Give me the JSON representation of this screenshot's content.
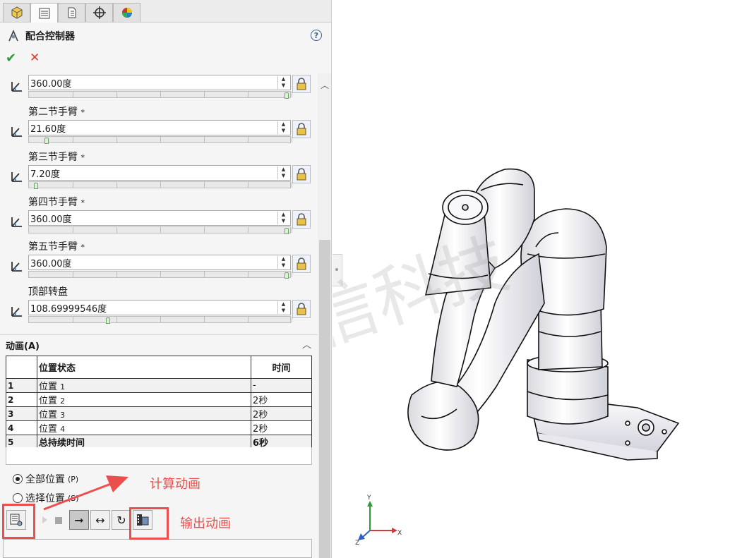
{
  "property_manager": {
    "title": "配合控制器",
    "help": "?",
    "ok": "✔",
    "cancel": "✕"
  },
  "mates": [
    {
      "label": "",
      "value": "360.00度",
      "slider": 1.0
    },
    {
      "label": "第二节手臂",
      "required": "*",
      "value": "21.60度",
      "slider": 0.06
    },
    {
      "label": "第三节手臂",
      "required": "*",
      "value": "7.20度",
      "slider": 0.02
    },
    {
      "label": "第四节手臂",
      "required": "*",
      "value": "360.00度",
      "slider": 1.0
    },
    {
      "label": "第五节手臂",
      "required": "*",
      "value": "360.00度",
      "slider": 1.0
    },
    {
      "label": "顶部转盘",
      "required": "",
      "value": "108.69999546度",
      "slider": 0.3
    }
  ],
  "animation": {
    "section_title": "动画(A)",
    "col_position": "位置状态",
    "col_time": "时间",
    "rows": [
      {
        "idx": "1",
        "name": "位置",
        "num": "1",
        "time": "-"
      },
      {
        "idx": "2",
        "name": "位置",
        "num": "2",
        "time": "2秒"
      },
      {
        "idx": "3",
        "name": "位置",
        "num": "3",
        "time": "2秒"
      },
      {
        "idx": "4",
        "name": "位置",
        "num": "4",
        "time": "2秒"
      }
    ],
    "total": {
      "idx": "5",
      "name": "总持续时间",
      "time": "6秒"
    },
    "radio_all": "全部位置",
    "radio_all_key": "(P)",
    "radio_select": "选择位置",
    "radio_select_key": "(S)"
  },
  "annotations": {
    "compute": "计算动画",
    "output": "输出动画"
  },
  "watermark": "生信科技",
  "triad": {
    "x": "X",
    "y": "Y",
    "z": "Z"
  },
  "colors": {
    "accent_red": "#ec4e4e",
    "ok_green": "#2e9b3a",
    "panel_bg": "#f5f5f5"
  }
}
